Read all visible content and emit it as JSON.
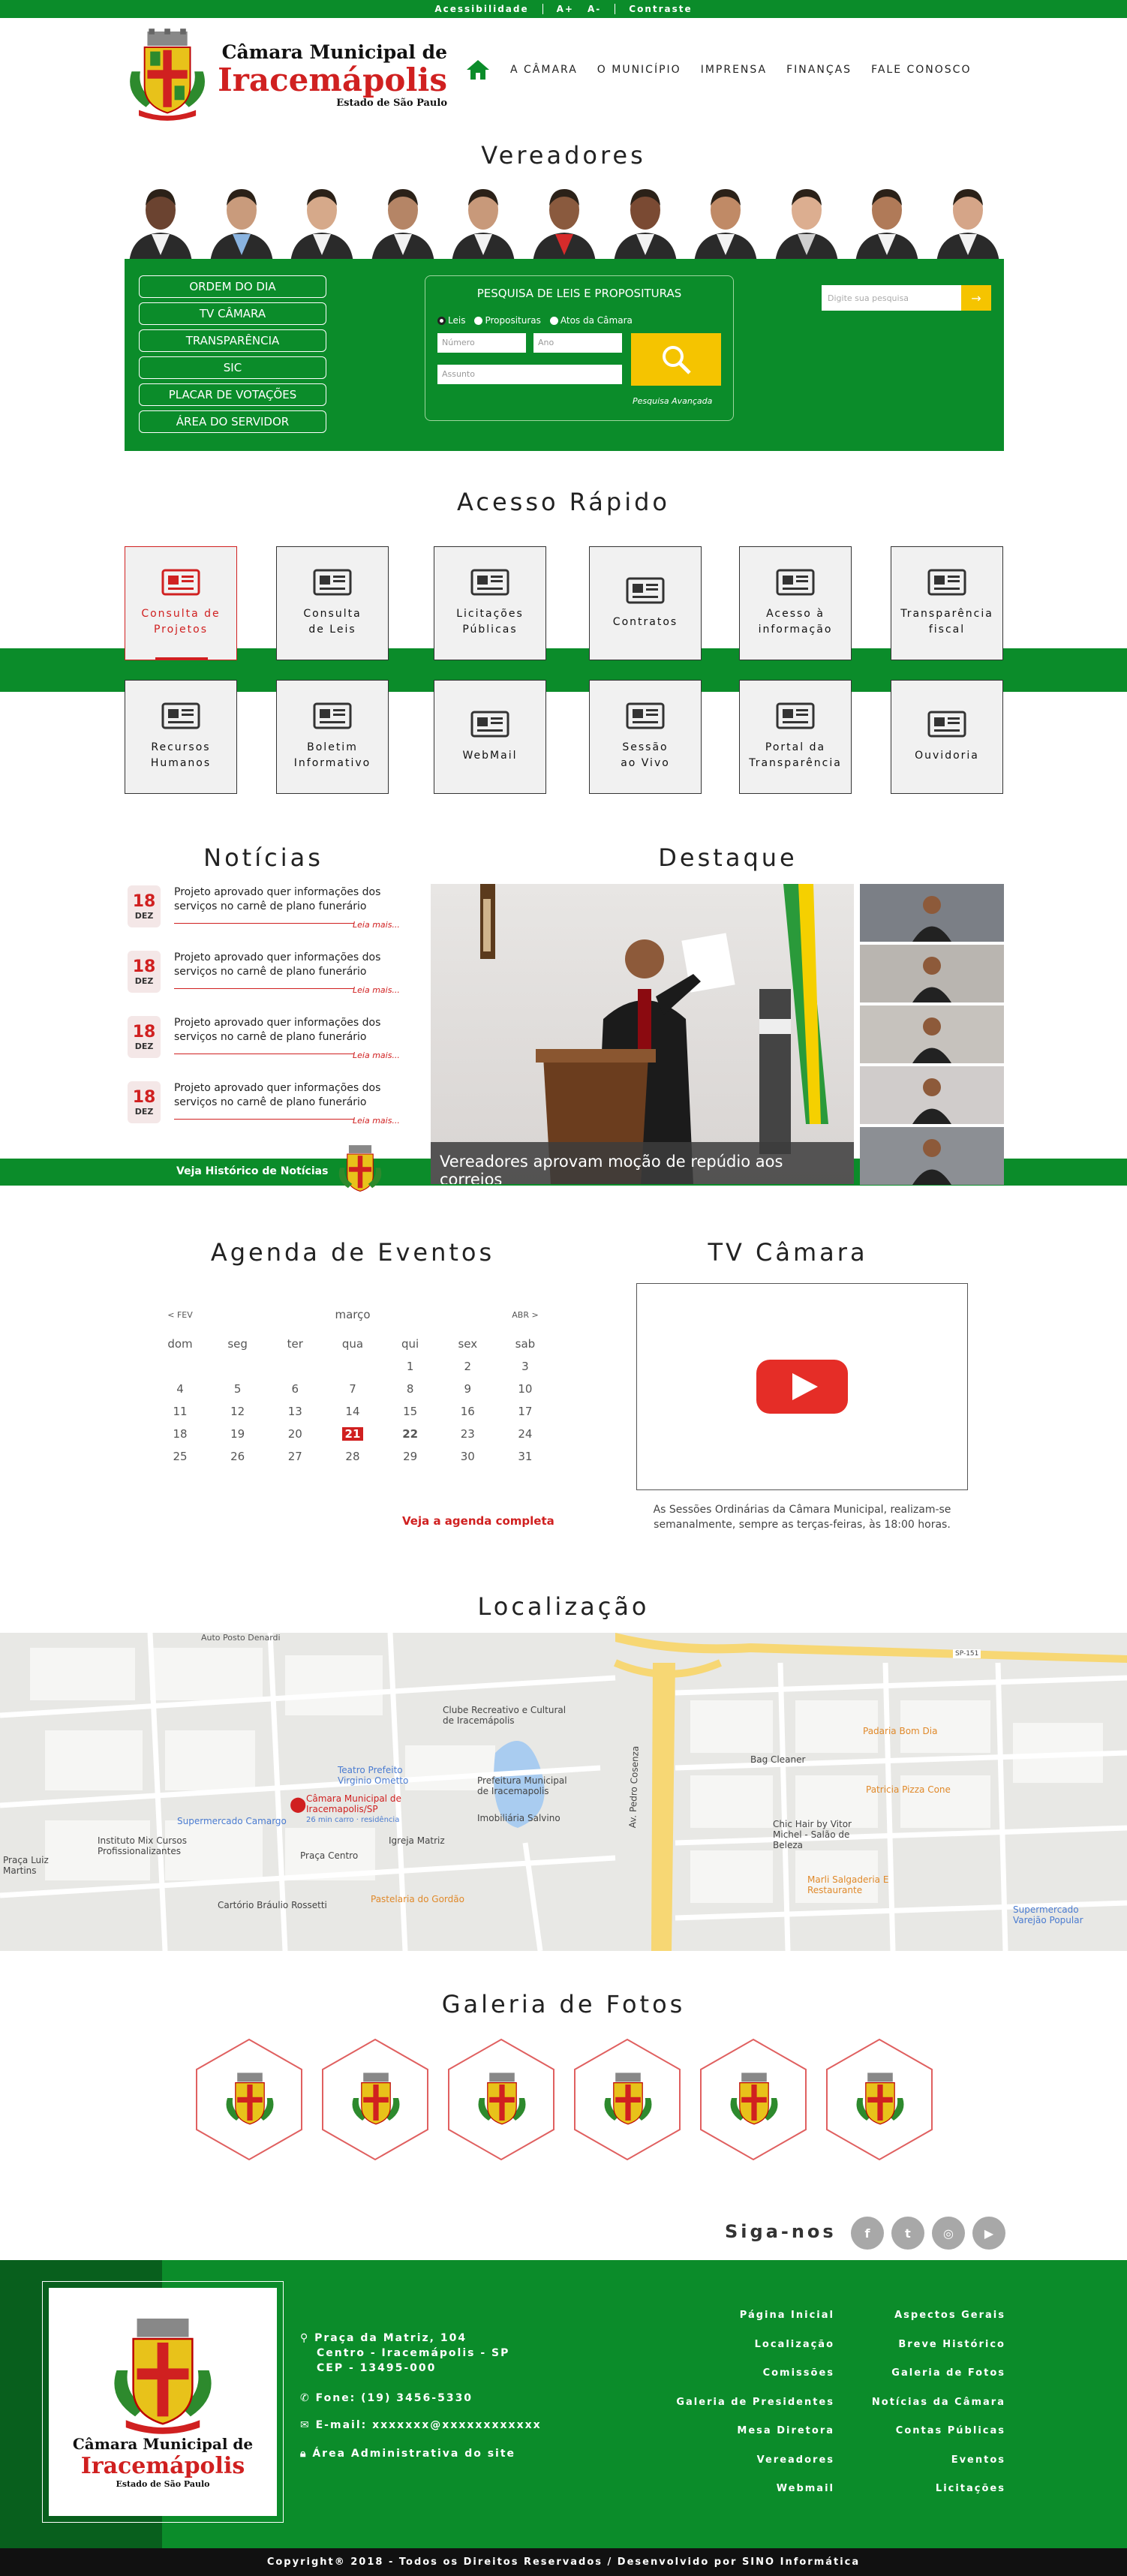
{
  "topbar": {
    "items": [
      "Acessibilidade",
      "A+",
      "A-",
      "Contraste"
    ]
  },
  "logo": {
    "line1": "Câmara Municipal de",
    "line2": "Iracemápolis",
    "line3": "Estado de São Paulo"
  },
  "nav": {
    "items": [
      "A CÂMARA",
      "O MUNICÍPIO",
      "IMPRENSA",
      "FINANÇAS",
      "FALE CONOSCO"
    ]
  },
  "vereadores": {
    "title": "Vereadores"
  },
  "sidebar": {
    "buttons": [
      "ORDEM DO DIA",
      "TV CÂMARA",
      "TRANSPARÊNCIA",
      "SIC",
      "PLACAR DE VOTAÇÕES",
      "ÁREA DO SERVIDOR"
    ]
  },
  "leis_search": {
    "title": "PESQUISA DE LEIS E PROPOSITURAS",
    "radios": [
      "Leis",
      "Proposituras",
      "Atos da Câmara"
    ],
    "numero_placeholder": "Número",
    "ano_placeholder": "Ano",
    "assunto_placeholder": "Assunto",
    "advanced": "Pesquisa Avançada"
  },
  "site_search": {
    "placeholder": "Digite sua pesquisa"
  },
  "acesso_rapido": {
    "title": "Acesso Rápido",
    "tiles": [
      {
        "line1": "Consulta de",
        "line2": "Projetos"
      },
      {
        "line1": "Consulta",
        "line2": "de Leis"
      },
      {
        "line1": "Licitações",
        "line2": "Públicas"
      },
      {
        "line1": "Contratos",
        "line2": ""
      },
      {
        "line1": "Acesso à",
        "line2": "informação"
      },
      {
        "line1": "Transparência",
        "line2": "fiscal"
      },
      {
        "line1": "Recursos",
        "line2": "Humanos"
      },
      {
        "line1": "Boletim",
        "line2": "Informativo"
      },
      {
        "line1": "WebMail",
        "line2": ""
      },
      {
        "line1": "Sessão",
        "line2": "ao Vivo"
      },
      {
        "line1": "Portal da",
        "line2": "Transparência"
      },
      {
        "line1": "Ouvidoria",
        "line2": ""
      }
    ]
  },
  "noticias": {
    "title": "Notícias",
    "items": [
      {
        "day": "18",
        "month": "DEZ",
        "text": "Projeto aprovado quer informações dos serviços no carnê de plano funerário",
        "more": "Leia mais..."
      },
      {
        "day": "18",
        "month": "DEZ",
        "text": "Projeto aprovado quer informações dos serviços no carnê de plano funerário",
        "more": "Leia mais..."
      },
      {
        "day": "18",
        "month": "DEZ",
        "text": "Projeto aprovado quer informações dos serviços no carnê de plano funerário",
        "more": "Leia mais..."
      },
      {
        "day": "18",
        "month": "DEZ",
        "text": "Projeto aprovado quer informações dos serviços no carnê de plano funerário",
        "more": "Leia mais..."
      }
    ],
    "history": "Veja Histórico de Notícias"
  },
  "destaque": {
    "title": "Destaque",
    "caption": "Vereadores aprovam moção de repúdio aos correios"
  },
  "agenda": {
    "title": "Agenda de Eventos",
    "prev": "< FEV",
    "month": "março",
    "next": "ABR >",
    "weekdays": [
      "dom",
      "seg",
      "ter",
      "qua",
      "qui",
      "sex",
      "sab"
    ],
    "weeks": [
      [
        "",
        "",
        "",
        "",
        "1",
        "2",
        "3"
      ],
      [
        "4",
        "5",
        "6",
        "7",
        "8",
        "9",
        "10"
      ],
      [
        "11",
        "12",
        "13",
        "14",
        "15",
        "16",
        "17"
      ],
      [
        "18",
        "19",
        "20",
        "21",
        "22",
        "23",
        "24"
      ],
      [
        "25",
        "26",
        "27",
        "28",
        "29",
        "30",
        "31"
      ]
    ],
    "today": "21",
    "link": "Veja a agenda completa"
  },
  "tv": {
    "title": "TV Câmara",
    "text": "As Sessões Ordinárias da Câmara Municipal, realizam-se semanalmente, sempre as terças-feiras, às 18:00 horas."
  },
  "localizacao": {
    "title": "Localização",
    "labels": {
      "posto": "Auto Posto Denardi",
      "clube": "Clube Recreativo e Cultural de Iracemápolis",
      "teatro": "Teatro Prefeito Virginio Ometto",
      "prefeitura": "Prefeitura Municipal de Iracemapolis",
      "camara": "Câmara Municipal de Iracemapolis/SP",
      "camara_sub": "26 min carro · residência",
      "supermercado": "Supermercado Camargo",
      "instituto": "Instituto Mix Cursos Profissionalizantes",
      "praca": "Praça Centro",
      "matriz": "Igreja Matriz",
      "salvino": "Imobiliária Salvino",
      "cartorio": "Cartório Bráulio Rossetti",
      "pastelaria": "Pastelaria do Gordão",
      "bag": "Bag Cleaner",
      "padaria": "Padaria Bom Dia",
      "pizza": "Patricia Pizza Cone",
      "chic": "Chic Hair by Vitor Michel - Salão de Beleza",
      "marli": "Marli Salgaderia E Restaurante",
      "varejao": "Supermercado Varejão Popular",
      "praca_lm": "Praça Luiz Martins",
      "avenida": "Av. Pedro Cosenza",
      "sp151": "SP-151"
    }
  },
  "galeria": {
    "title": "Galeria de Fotos",
    "count": 6
  },
  "social": {
    "title": "Siga-nos",
    "icons": [
      "f",
      "t",
      "◎",
      "▶"
    ]
  },
  "footer": {
    "address1": "Praça da Matriz, 104",
    "address2": "Centro - Iracemápolis - SP",
    "address3": "CEP - 13495-000",
    "phone": "Fone: (19) 3456-5330",
    "email": "E-mail: xxxxxxx@xxxxxxxxxxxx",
    "admin": "Área Administrativa do site",
    "col1": [
      "Página Inicial",
      "Localização",
      "Comissões",
      "Galeria de Presidentes",
      "Mesa Diretora",
      "Vereadores",
      "Webmail"
    ],
    "col2": [
      "Aspectos Gerais",
      "Breve Histórico",
      "Galeria de Fotos",
      "Notícias da Câmara",
      "Contas Públicas",
      "Eventos",
      "Licitações"
    ]
  },
  "copyright": "Copyright® 2018 - Todos os Direitos Reservados / Desenvolvido por SINO Informática",
  "colors": {
    "green": "#0b8c2a",
    "red": "#d02020",
    "yellow": "#f5c400"
  }
}
